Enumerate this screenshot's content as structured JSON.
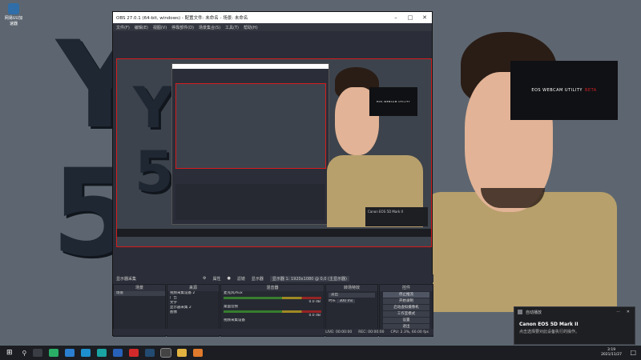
{
  "desktop": {
    "icon_label": "网易UU加速器",
    "art_letters": [
      "Y",
      "5"
    ],
    "banner": {
      "brand": "EOS WEBCAM UTILITY",
      "tag": "BETA"
    }
  },
  "obs": {
    "title": "OBS 27.0.1 (64-bit, windows) - 配置文件: 未命名 - 场景: 未命名",
    "menu": [
      "文件(F)",
      "编辑(E)",
      "视图(V)",
      "停靠部件(D)",
      "场景集合(S)",
      "工具(T)",
      "帮助(H)"
    ],
    "scene_strip": {
      "source_name": "显示器采集",
      "properties": "属性",
      "filters": "滤镜",
      "display_label": "显示器",
      "display_value": "显示器 1: 1920x1080 @ 0,0 (主显示器)"
    },
    "docks": {
      "scenes": {
        "title": "场景",
        "items": [
          "场景"
        ]
      },
      "sources": {
        "title": "来源",
        "items": [
          "视频采集设备 2",
          "广告",
          "文字",
          "显示器采集 2",
          "图像"
        ]
      },
      "mixer": {
        "title": "混音器",
        "channels": [
          {
            "name": "麦克风/Aux",
            "db": "0.0 dB"
          },
          {
            "name": "桌面音频",
            "db": "0.0 dB"
          },
          {
            "name": "视频采集设备",
            "db": "0.0 dB"
          }
        ]
      },
      "transitions": {
        "title": "转场特效",
        "type": "淡出",
        "duration_label": "时长",
        "duration": "300 ms"
      },
      "controls": {
        "title": "控件",
        "buttons": [
          "停止推流",
          "开始录制",
          "启动虚拟摄像机",
          "工作室模式",
          "设置",
          "退出"
        ]
      }
    },
    "statusbar": {
      "live": "LIVE: 00:00:00",
      "rec": "REC: 00:00:00",
      "cpu": "CPU: 2.3%, 60.00 fps"
    }
  },
  "notification": {
    "app": "自动播放",
    "title": "Canon EOS 5D Mark II",
    "body": "点击选择要对此设备执行的操作。"
  },
  "taskbar": {
    "time": "3:19",
    "date": "2021/11/27"
  },
  "colors": {
    "selection_red": "#d51c1c",
    "desktop_bg": "#5d6670",
    "obs_bg": "#2b2e38"
  }
}
